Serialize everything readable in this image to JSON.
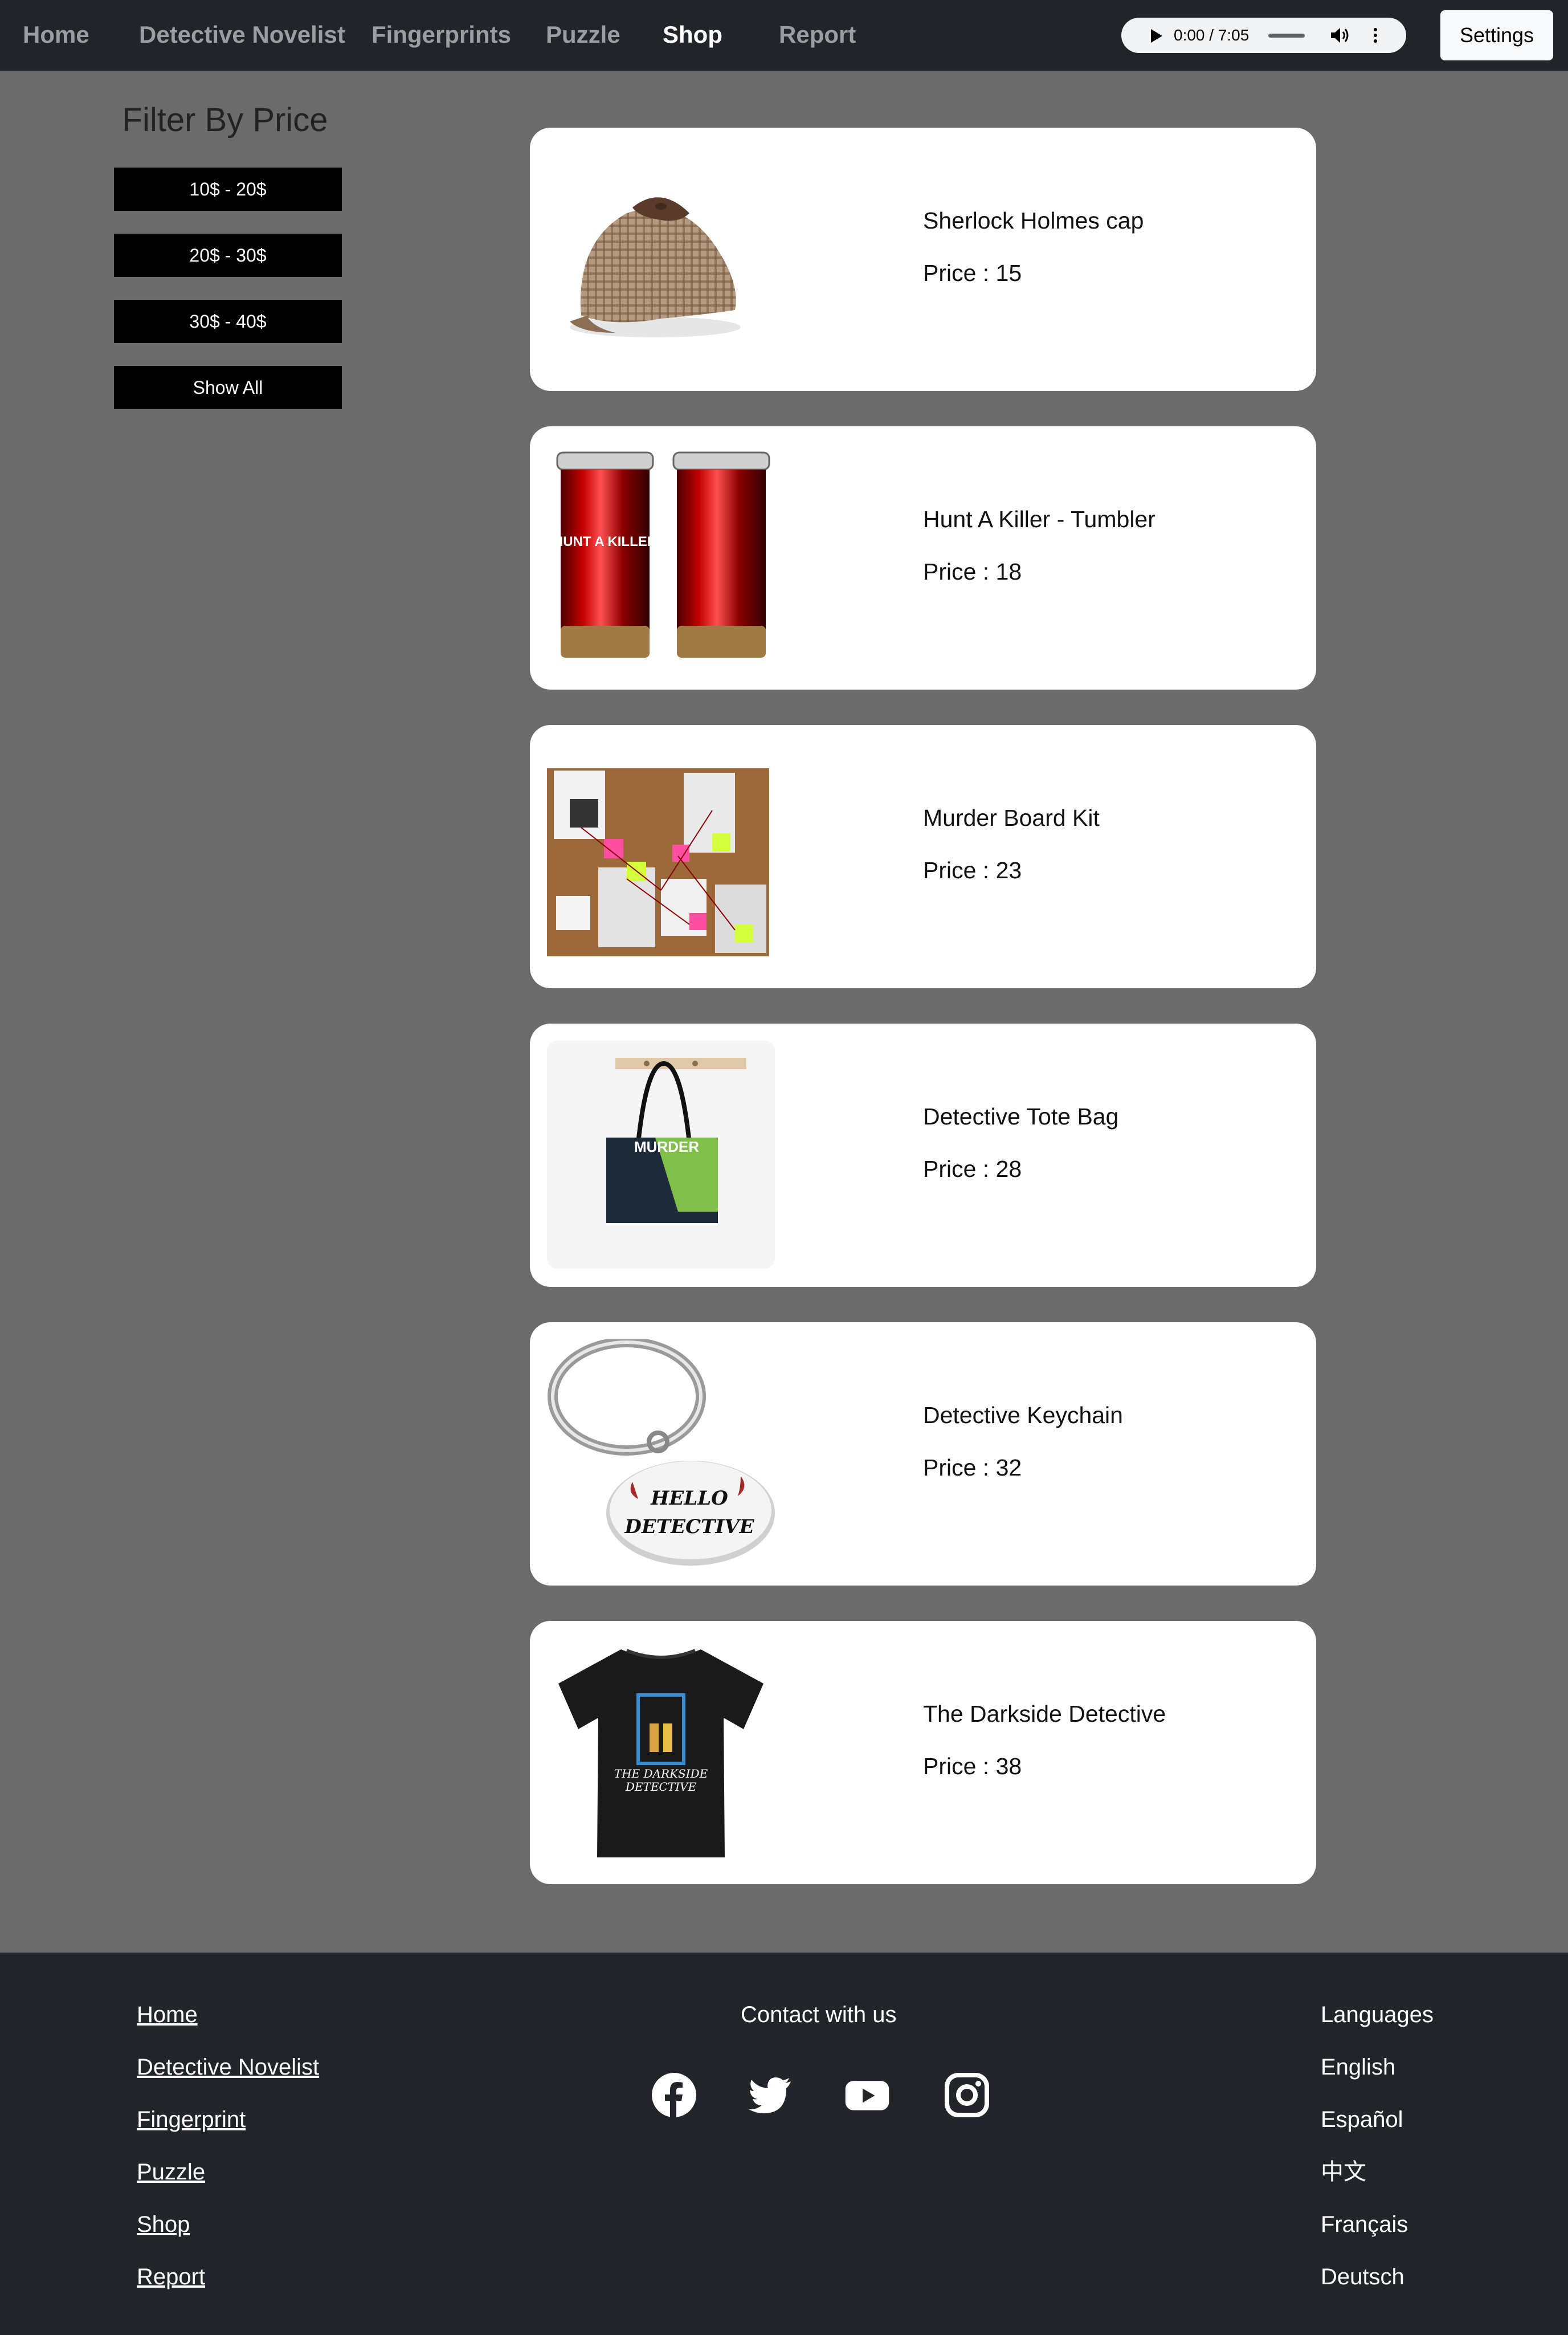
{
  "nav": {
    "links": [
      "Home",
      "Detective Novelist",
      "Fingerprints",
      "Puzzle",
      "Shop",
      "Report"
    ],
    "active": "Shop",
    "audio_time": "0:00 / 7:05",
    "settings_label": "Settings"
  },
  "sidebar": {
    "title": "Filter By Price",
    "filters": [
      "10$ - 20$",
      "20$ - 30$",
      "30$ - 40$",
      "Show All"
    ]
  },
  "products": [
    {
      "name": "Sherlock Holmes cap",
      "price": "Price : 15",
      "image": "deerstalker-cap-image"
    },
    {
      "name": "Hunt A Killer - Tumbler",
      "price": "Price : 18",
      "image": "red-tumblers-image",
      "image_text": "HUNT A KILLER"
    },
    {
      "name": "Murder Board Kit",
      "price": "Price : 23",
      "image": "murder-board-image"
    },
    {
      "name": "Detective Tote Bag",
      "price": "Price : 28",
      "image": "tote-bag-image",
      "image_text": "MURDER"
    },
    {
      "name": "Detective Keychain",
      "price": "Price : 32",
      "image": "keychain-image",
      "image_text": [
        "HELLO",
        "DETECTIVE"
      ]
    },
    {
      "name": "The Darkside Detective",
      "price": "Price : 38",
      "image": "tshirt-image",
      "image_text": [
        "THE DARKSIDE",
        "DETECTIVE"
      ]
    }
  ],
  "footer": {
    "links": [
      "Home",
      "Detective Novelist",
      "Fingerprint",
      "Puzzle",
      "Shop",
      "Report"
    ],
    "contact_title": "Contact with us",
    "social": [
      "facebook-icon",
      "twitter-icon",
      "youtube-icon",
      "instagram-icon"
    ],
    "languages_title": "Languages",
    "languages": [
      "English",
      "Español",
      "中文",
      "Français",
      "Deutsch"
    ]
  },
  "colors": {
    "navbar_bg": "#212529",
    "page_bg": "#6b6b6b",
    "card_bg": "#ffffff",
    "filter_button_bg": "#000000",
    "nav_inactive": "#9a9da1"
  }
}
